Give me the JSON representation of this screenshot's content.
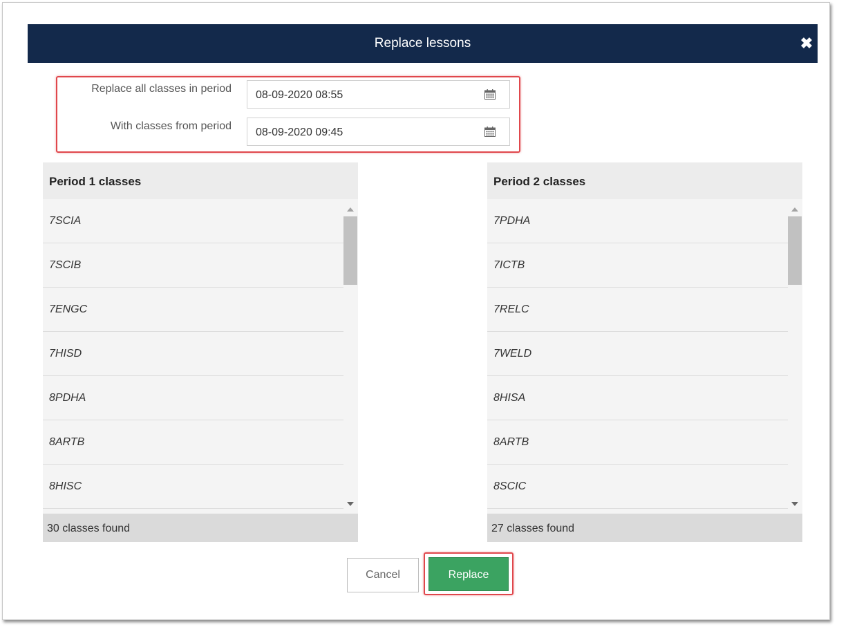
{
  "dialog": {
    "title": "Replace lessons",
    "close_icon": "close-icon"
  },
  "form": {
    "replace_label": "Replace all classes in period",
    "replace_value": "08-09-2020 08:55",
    "with_label": "With classes from period",
    "with_value": "08-09-2020 09:45",
    "field_icon": "calendar-icon"
  },
  "period1": {
    "title": "Period 1 classes",
    "items": [
      "7SCIA",
      "7SCIB",
      "7ENGC",
      "7HISD",
      "8PDHA",
      "8ARTB",
      "8HISC"
    ],
    "count": "30 classes found"
  },
  "period2": {
    "title": "Period 2 classes",
    "items": [
      "7PDHA",
      "7ICTB",
      "7RELC",
      "7WELD",
      "8HISA",
      "8ARTB",
      "8SCIC"
    ],
    "count": "27 classes found"
  },
  "buttons": {
    "cancel": "Cancel",
    "replace": "Replace"
  },
  "colors": {
    "header_bg": "#13294b",
    "replace_bg": "#3ba361",
    "highlight": "#e0474c"
  }
}
